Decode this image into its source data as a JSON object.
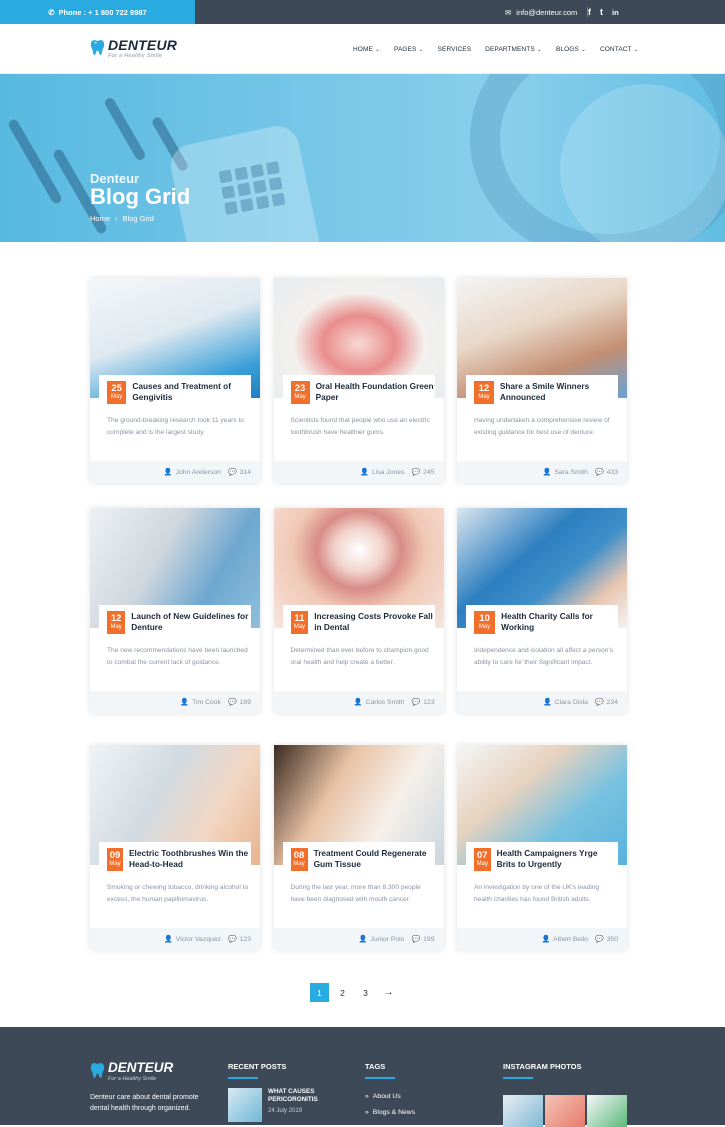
{
  "topbar": {
    "phone_label": "Phone : + 1 800 722 8987",
    "email": "info@denteur.com",
    "socials": [
      "f",
      "t",
      "in"
    ]
  },
  "brand": {
    "name": "DENTEUR",
    "tagline": "For a Healthy Smile"
  },
  "nav": {
    "items": [
      {
        "label": "HOME",
        "has_dropdown": true
      },
      {
        "label": "PAGES",
        "has_dropdown": true
      },
      {
        "label": "SERVICES",
        "has_dropdown": false
      },
      {
        "label": "DEPARTMENTS",
        "has_dropdown": true
      },
      {
        "label": "BLOGS",
        "has_dropdown": true
      },
      {
        "label": "CONTACT",
        "has_dropdown": true
      }
    ]
  },
  "hero": {
    "subtitle": "Denteur",
    "title": "Blog Grid",
    "breadcrumb": [
      "Home",
      "Blog Grid"
    ],
    "separator": "›"
  },
  "posts": [
    {
      "day": "25",
      "month": "May",
      "title": "Causes and Treatment of Gengivitis",
      "excerpt": "The ground-breaking research took 11 years to complete and is the largest study.",
      "author": "John Anderson",
      "comments": "314",
      "img": "dentist-mask"
    },
    {
      "day": "23",
      "month": "May",
      "title": "Oral Health Foundation Green Paper",
      "excerpt": "Scientists found that people who use an electric toothbrush have healthier gums.",
      "author": "Lisa Jones",
      "comments": "245",
      "img": "teeth-model"
    },
    {
      "day": "12",
      "month": "May",
      "title": "Share a Smile Winners Announced",
      "excerpt": "Having undertaken a comprehensive review of existing guidance for best use of denture.",
      "author": "Sara Smith",
      "comments": "433",
      "img": "family"
    },
    {
      "day": "12",
      "month": "May",
      "title": "Launch of New Guidelines for Denture",
      "excerpt": "The new recommendations have been launched to combat the current lack of guidance.",
      "author": "Tim Cook",
      "comments": "189",
      "img": "xray"
    },
    {
      "day": "11",
      "month": "May",
      "title": "Increasing Costs Provoke Fall in Dental",
      "excerpt": "Determined than ever before to champion good oral health and help create a better.",
      "author": "Carlos Smith",
      "comments": "123",
      "img": "smile"
    },
    {
      "day": "10",
      "month": "May",
      "title": "Health Charity Calls for Working",
      "excerpt": "Independence and isolation all affect a person's ability to care for their Significant impact.",
      "author": "Clara Disla",
      "comments": "234",
      "img": "checkup"
    },
    {
      "day": "09",
      "month": "May",
      "title": "Electric Toothbrushes Win the Head-to-Head",
      "excerpt": "Smoking or chewing tobacco, drinking alcohol to excess, the human papillomavirus.",
      "author": "Victor Vazquez",
      "comments": "123",
      "img": "doctor-patient"
    },
    {
      "day": "08",
      "month": "May",
      "title": "Treatment Could Regenerate Gum Tissue",
      "excerpt": "During the last year, more than 8,300 people have been diagnosed with mouth cancer.",
      "author": "Junior Polo",
      "comments": "199",
      "img": "woman-smile"
    },
    {
      "day": "07",
      "month": "May",
      "title": "Health Campaigners Yrge Brits to Urgently",
      "excerpt": "An investigation by one of the UK's leading health charities has found British adults.",
      "author": "Albert Bello",
      "comments": "350",
      "img": "child-dentist"
    }
  ],
  "pagination": {
    "pages": [
      "1",
      "2",
      "3"
    ],
    "active": "1",
    "next": "→"
  },
  "footer": {
    "about": "Denteur care about dental promote dental health through organized.",
    "recent_title": "RECENT POSTS",
    "recent_post": {
      "title": "WHAT CAUSES PERICORONITIS",
      "date": "24 July 2019"
    },
    "tags_title": "TAGS",
    "tags": [
      "About Us",
      "Blogs & News"
    ],
    "instagram_title": "INSTAGRAM PHOTOS"
  },
  "colors": {
    "accent": "#29abe2",
    "date_badge": "#f26e2b",
    "dark": "#3e4957"
  }
}
